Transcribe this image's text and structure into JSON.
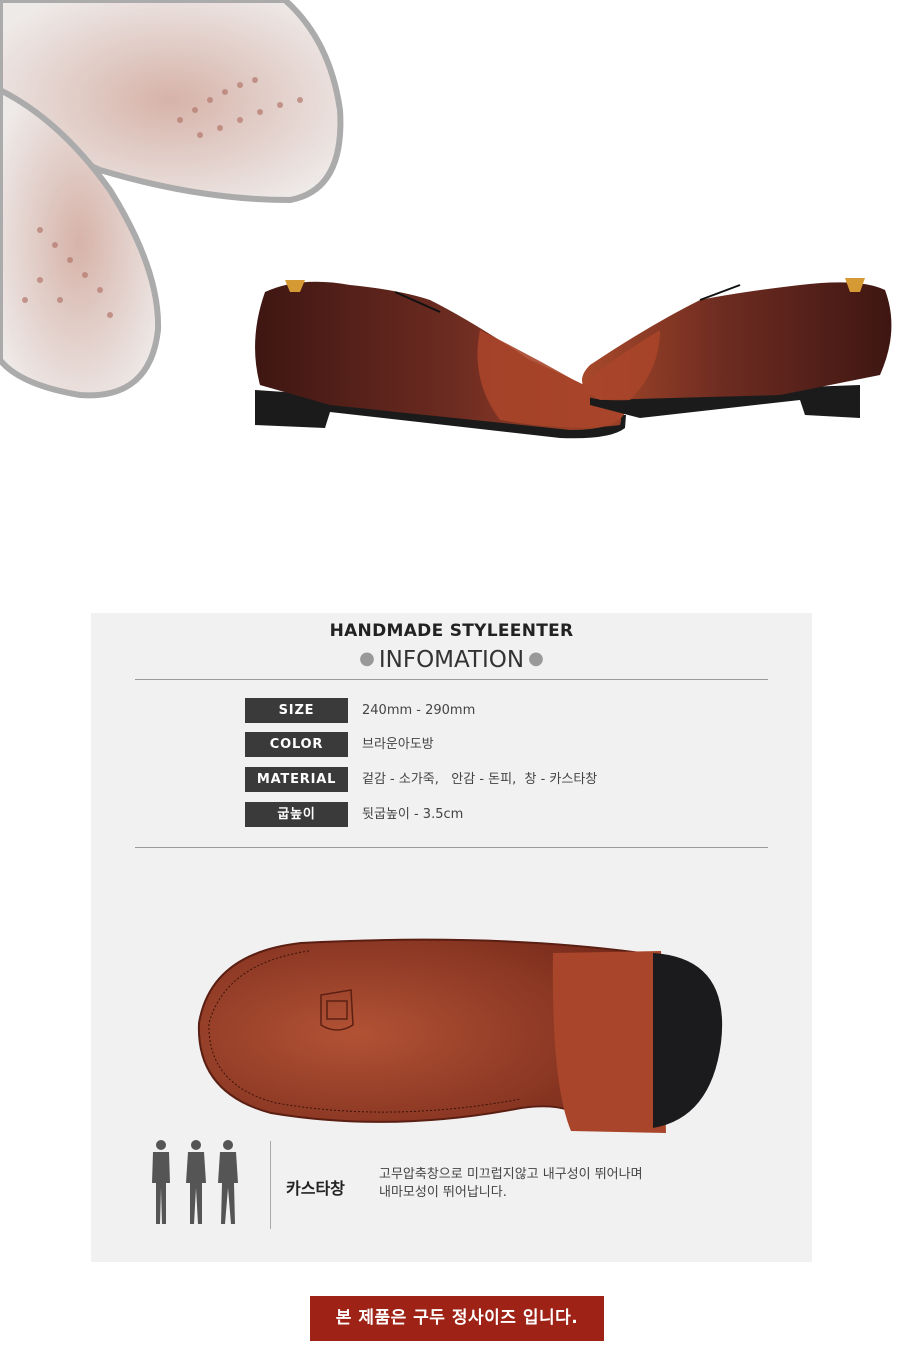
{
  "hero": {
    "image_desc": "brown-handmade-wholecut-brogue-shoes"
  },
  "info": {
    "brand_title": "HANDMADE STYLEENTER",
    "section_title": "INFOMATION",
    "specs": [
      {
        "label": "SIZE",
        "value": "240mm - 290mm"
      },
      {
        "label": "COLOR",
        "value": "브라운아도방"
      },
      {
        "label": "MATERIAL",
        "value": "겉감 - 소가죽,   안감 - 돈피,  창 - 카스타창"
      },
      {
        "label": "굽높이",
        "value": "뒷굽높이 - 3.5cm"
      }
    ]
  },
  "sole": {
    "name": "카스타창",
    "desc_line1": "고무압축창으로 미끄럽지않고 내구성이 뛰어나며",
    "desc_line2": "내마모성이 뛰어납니다."
  },
  "notice": "본 제품은 구두 정사이즈 입니다.",
  "colors": {
    "accent": "#9e2215",
    "label_bg": "#3a3a3a",
    "panel_bg": "#f1f1f1",
    "leather": "#6b2a1e",
    "sole": "#a8452a"
  }
}
